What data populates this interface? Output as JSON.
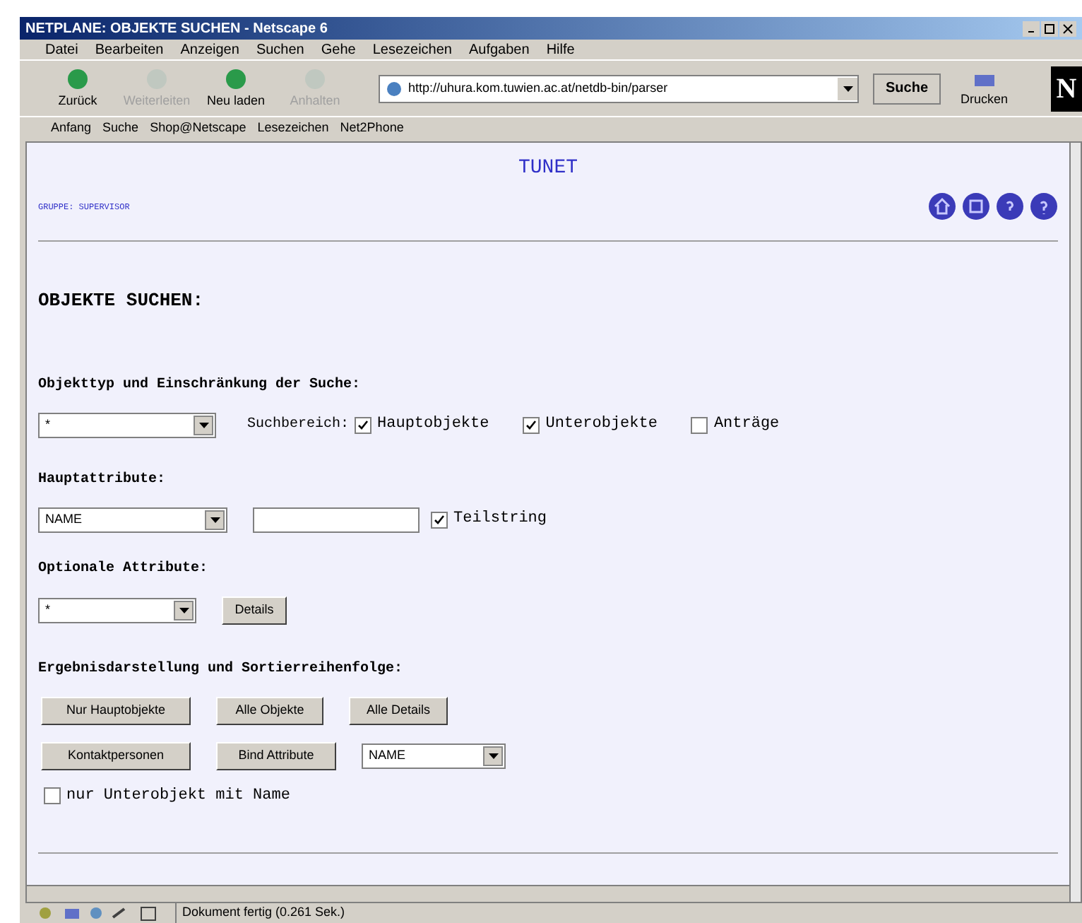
{
  "window": {
    "title": "NETPLANE: OBJEKTE SUCHEN - Netscape 6"
  },
  "menu": [
    "Datei",
    "Bearbeiten",
    "Anzeigen",
    "Suchen",
    "Gehe",
    "Lesezeichen",
    "Aufgaben",
    "Hilfe"
  ],
  "toolbar": [
    {
      "label": "Zurück",
      "disabled": false
    },
    {
      "label": "Weiterleiten",
      "disabled": true
    },
    {
      "label": "Neu laden",
      "disabled": false
    },
    {
      "label": "Anhalten",
      "disabled": true
    }
  ],
  "address": {
    "value": "http://uhura.kom.tuwien.ac.at/netdb-bin/parser"
  },
  "search_button": "Suche",
  "print_button": "Drucken",
  "logo": "N",
  "personal_bar": [
    "Anfang",
    "Suche",
    "Shop@Netscape",
    "Lesezeichen",
    "Net2Phone"
  ],
  "page": {
    "site_title": "TUNET",
    "group": "GRUPPE: SUPERVISOR",
    "heading": "OBJEKTE SUCHEN:",
    "type_section": {
      "label": "Objekttyp und Einschränkung der Suche:",
      "select": "*",
      "scope_label": "Suchbereich:",
      "scopes": [
        {
          "label": "Hauptobjekte",
          "checked": true
        },
        {
          "label": "Unterobjekte",
          "checked": true
        },
        {
          "label": "Anträge",
          "checked": false
        }
      ]
    },
    "main_section": {
      "label": "Hauptattribute:",
      "select": "NAME",
      "substring": {
        "label": "Teilstring",
        "checked": true
      }
    },
    "optional_section": {
      "label": "Optionale Attribute:",
      "select": "*",
      "button": "Details"
    },
    "result_section": {
      "label": "Ergebnisdarstellung und Sortierreihenfolge:",
      "row1": [
        "Nur Hauptobjekte",
        "Alle Objekte",
        "Alle Details"
      ],
      "row2": [
        "Kontaktpersonen",
        "Bind Attribute"
      ],
      "sort_select": "NAME",
      "only_named": {
        "label": "nur Unterobjekt mit Name",
        "checked": false
      }
    }
  },
  "status_bar": {
    "text": "Dokument fertig (0.261 Sek.)"
  }
}
